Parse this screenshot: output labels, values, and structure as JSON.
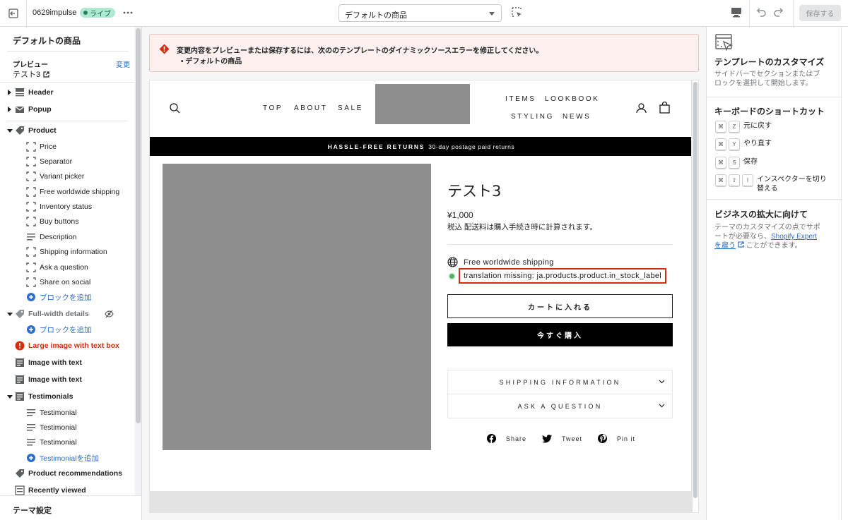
{
  "topbar": {
    "store_name": "0629impulse",
    "live_badge": "ライブ",
    "template_select": "デフォルトの商品",
    "save_button": "保存する"
  },
  "sidebar": {
    "title": "デフォルトの商品",
    "preview_label": "プレビュー",
    "change_link": "変更",
    "preview_value": "テスト3",
    "items": [
      {
        "label": "Header"
      },
      {
        "label": "Popup"
      },
      {
        "label": "Product"
      },
      {
        "label": "Price"
      },
      {
        "label": "Separator"
      },
      {
        "label": "Variant picker"
      },
      {
        "label": "Free worldwide shipping"
      },
      {
        "label": "Inventory status"
      },
      {
        "label": "Buy buttons"
      },
      {
        "label": "Description"
      },
      {
        "label": "Shipping information"
      },
      {
        "label": "Ask a question"
      },
      {
        "label": "Share on social"
      },
      {
        "label": "ブロックを追加"
      },
      {
        "label": "Full-width details"
      },
      {
        "label": "ブロックを追加"
      },
      {
        "label": "Large image with text box"
      },
      {
        "label": "Image with text"
      },
      {
        "label": "Image with text"
      },
      {
        "label": "Testimonials"
      },
      {
        "label": "Testimonial"
      },
      {
        "label": "Testimonial"
      },
      {
        "label": "Testimonial"
      },
      {
        "label": "Testimonialを追加"
      },
      {
        "label": "Product recommendations"
      },
      {
        "label": "Recently viewed"
      }
    ],
    "footer": "テーマ設定"
  },
  "banner": {
    "message": "変更内容をプレビューまたは保存するには、次ののテンプレートのダイナミックソースエラーを修正してください。",
    "item": "• デフォルトの商品"
  },
  "store": {
    "nav_left": [
      "TOP",
      "ABOUT",
      "SALE"
    ],
    "nav_right_top": [
      "ITEMS",
      "LOOKBOOK"
    ],
    "nav_right_bottom": [
      "STYLING",
      "NEWS"
    ],
    "announcement_bold": "HASSLE-FREE RETURNS",
    "announcement_text": "30-day postage paid returns",
    "product_title": "テスト3",
    "price": "¥1,000",
    "tax_note": "税込 配送料は購入手続き時に計算されます。",
    "shipping": "Free worldwide shipping",
    "stock_label": "translation missing: ja.products.product.in_stock_label",
    "add_to_cart": "カートに入れる",
    "buy_now": "今すぐ購入",
    "accordion": [
      "SHIPPING INFORMATION",
      "ASK A QUESTION"
    ],
    "social": [
      "Share",
      "Tweet",
      "Pin it"
    ]
  },
  "rpanel": {
    "customize_title": "テンプレートのカスタマイズ",
    "customize_text": "サイドバーでセクションまたはブロックを選択して開始します。",
    "shortcuts_title": "キーボードのショートカット",
    "shortcuts": [
      {
        "keys": [
          "⌘",
          "Z"
        ],
        "label": "元に戻す"
      },
      {
        "keys": [
          "⌘",
          "Y"
        ],
        "label": "やり直す"
      },
      {
        "keys": [
          "⌘",
          "S"
        ],
        "label": "保存"
      },
      {
        "keys": [
          "⌘",
          "⇧",
          "I"
        ],
        "label": "インスペクターを切り替える"
      }
    ],
    "business_title": "ビジネスの拡大に向けて",
    "business_text": "テーマのカスタマイズの点でサポートが必要なら、",
    "business_link": "Shopify Expertを雇う",
    "business_tail": "ことができます。"
  },
  "colors": {
    "accent_blue": "#2c6ecb",
    "error_red": "#d72c0d",
    "live_green": "#aee9d1"
  }
}
